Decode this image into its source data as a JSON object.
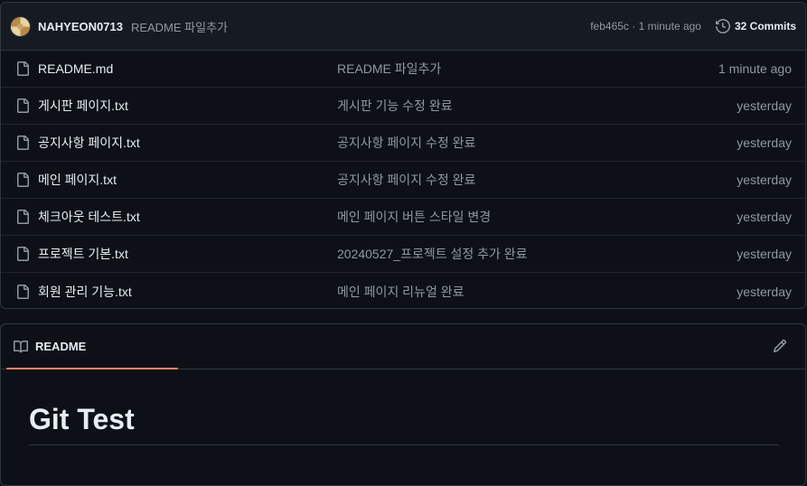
{
  "commit": {
    "author": "NAHYEON0713",
    "message": "README 파일추가",
    "sha_time": "feb465c · 1 minute ago",
    "commits_label": "32 Commits"
  },
  "files": [
    {
      "name": "README.md",
      "message": "README 파일추가",
      "age": "1 minute ago"
    },
    {
      "name": "게시판 페이지.txt",
      "message": "게시판 기능 수정 완료",
      "age": "yesterday"
    },
    {
      "name": "공지사항 페이지.txt",
      "message": "공지사항 페이지 수정 완료",
      "age": "yesterday"
    },
    {
      "name": "메인 페이지.txt",
      "message": "공지사항 페이지 수정 완료",
      "age": "yesterday"
    },
    {
      "name": "체크아웃 테스트.txt",
      "message": "메인 페이지 버튼 스타일 변경",
      "age": "yesterday"
    },
    {
      "name": "프로젝트 기본.txt",
      "message": "20240527_프로젝트 설정 추가 완료",
      "age": "yesterday"
    },
    {
      "name": "회원 관리 기능.txt",
      "message": "메인 페이지 리뉴얼 완료",
      "age": "yesterday"
    }
  ],
  "readme": {
    "tab_label": "README",
    "title": "Git Test"
  },
  "icons": {
    "file": "file-icon",
    "history": "history-icon",
    "book": "book-icon",
    "edit": "pencil-icon"
  },
  "colors": {
    "background": "#0d1117",
    "header_bg": "#161b22",
    "border": "#30363d",
    "muted_text": "#9198a1",
    "tab_underline": "#f78166"
  }
}
